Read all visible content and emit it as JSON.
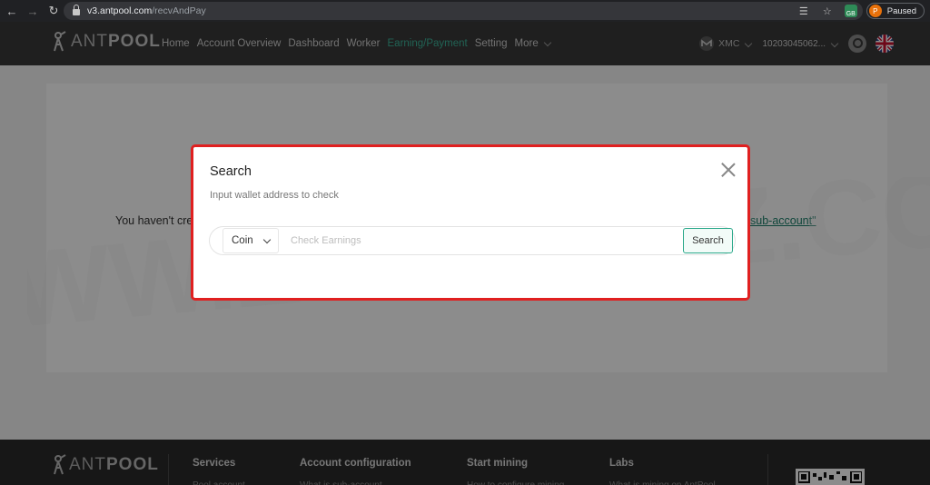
{
  "browser": {
    "url_host": "v3.antpool.com",
    "url_path": "/recvAndPay",
    "profile_initial": "P",
    "profile_status": "Paused",
    "ext_badge": "GB"
  },
  "header": {
    "logo_ant": "ANT",
    "logo_pool": "POOL",
    "nav": [
      {
        "label": "Home"
      },
      {
        "label": "Account Overview"
      },
      {
        "label": "Dashboard"
      },
      {
        "label": "Worker"
      },
      {
        "label": "Earning/Payment"
      },
      {
        "label": "Setting"
      },
      {
        "label": "More"
      }
    ],
    "coin": "XMC",
    "account": "10203045062..."
  },
  "page": {
    "empty_left": "You haven't cre",
    "empty_right": "sub-account\""
  },
  "modal": {
    "title": "Search",
    "subtitle": "Input wallet address to check",
    "coin_select": "Coin",
    "input_placeholder": "Check Earnings",
    "search_button": "Search"
  },
  "footer": {
    "logo_ant": "ANT",
    "logo_pool": "POOL",
    "columns": [
      {
        "title": "Services",
        "sub": "Pool account"
      },
      {
        "title": "Account configuration",
        "sub": "What is sub-account"
      },
      {
        "title": "Start mining",
        "sub": "How to configure mining"
      },
      {
        "title": "Labs",
        "sub": "What is mining on AntPool"
      }
    ]
  },
  "watermark": "WWW.ZOOMARZ.COM"
}
